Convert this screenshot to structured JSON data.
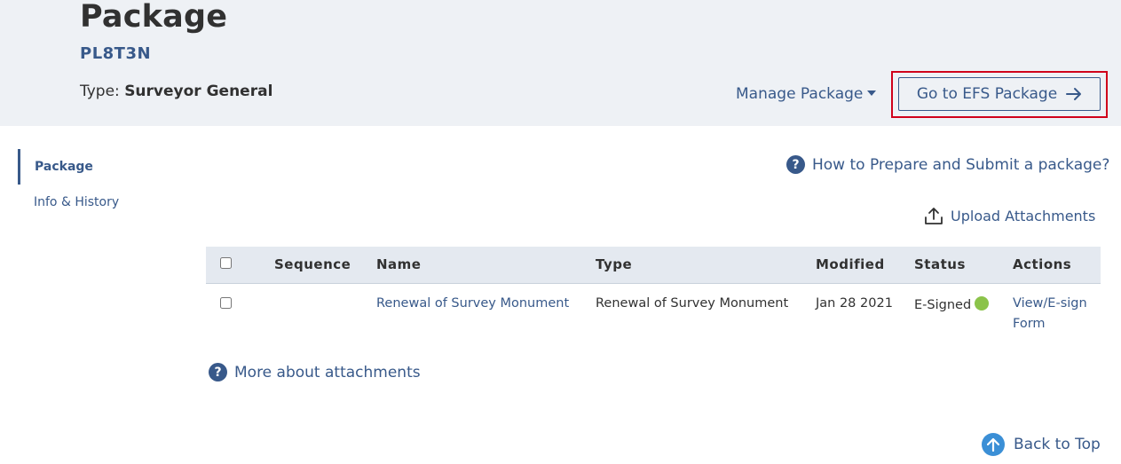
{
  "header": {
    "title": "Package",
    "package_id": "PL8T3N",
    "type_label": "Type:",
    "type_value": "Surveyor General",
    "manage_label": "Manage Package",
    "efs_button_label": "Go to EFS Package"
  },
  "sidebar": {
    "items": [
      {
        "label": "Package",
        "active": true
      },
      {
        "label": "Info & History",
        "active": false
      }
    ]
  },
  "help": {
    "prepare_link": "How to Prepare and Submit a package?",
    "more_link": "More about attachments",
    "icon": "question-circle-icon"
  },
  "upload": {
    "label": "Upload Attachments",
    "icon": "upload-icon"
  },
  "table": {
    "headers": [
      "Sequence",
      "Name",
      "Type",
      "Modified",
      "Status",
      "Actions"
    ],
    "rows": [
      {
        "sequence": "",
        "name": "Renewal of Survey Monument",
        "type": "Renewal of Survey Monument",
        "modified": "Jan 28 2021",
        "status": "E-Signed",
        "status_color": "#8bc34a",
        "action_line1": "View/E-sign",
        "action_line2": "Form"
      }
    ]
  },
  "footer": {
    "back_to_top": "Back to Top"
  },
  "colors": {
    "brand": "#38598a",
    "header_bg": "#eef1f5",
    "highlight": "#d0021b"
  }
}
